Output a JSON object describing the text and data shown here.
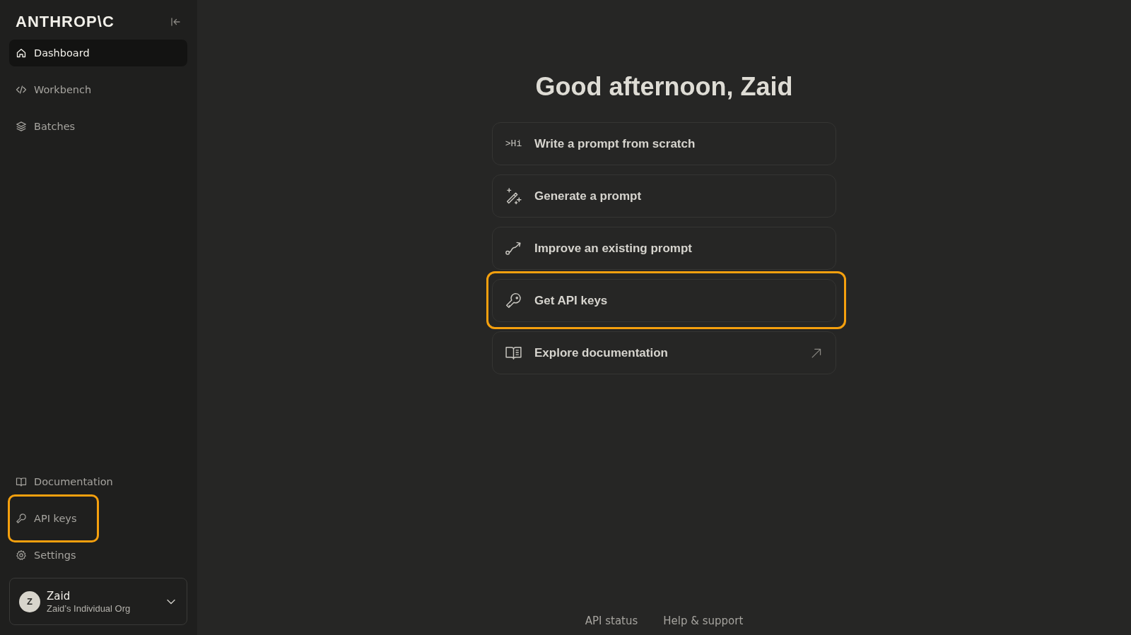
{
  "sidebar": {
    "logo": "ANTHROP\\C",
    "nav_items": [
      {
        "label": "Dashboard",
        "selected": true
      },
      {
        "label": "Workbench",
        "selected": false
      },
      {
        "label": "Batches",
        "selected": false
      }
    ],
    "bottom_items": [
      {
        "label": "Documentation",
        "highlighted": false
      },
      {
        "label": "API keys",
        "highlighted": true
      },
      {
        "label": "Settings",
        "highlighted": false
      }
    ],
    "user": {
      "avatar_initial": "Z",
      "name": "Zaid",
      "org": "Zaid’s Individual Org"
    }
  },
  "main": {
    "greeting": "Good afternoon, Zaid",
    "actions": [
      {
        "glyph": ">Hi",
        "label": "Write a prompt from scratch",
        "highlighted": false,
        "external": false
      },
      {
        "label": "Generate a prompt",
        "highlighted": false,
        "external": false
      },
      {
        "label": "Improve an existing prompt",
        "highlighted": false,
        "external": false
      },
      {
        "label": "Get API keys",
        "highlighted": true,
        "external": false
      },
      {
        "label": "Explore documentation",
        "highlighted": false,
        "external": true
      }
    ]
  },
  "footer": {
    "links": [
      "API status",
      "Help & support"
    ]
  }
}
